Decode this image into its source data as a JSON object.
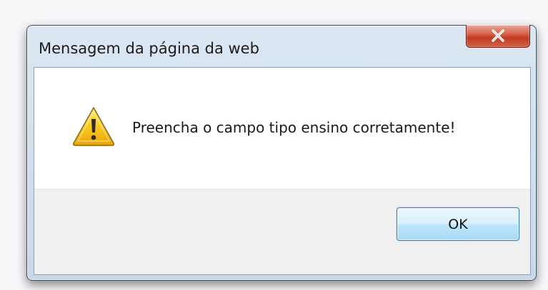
{
  "dialog": {
    "title": "Mensagem da página da web",
    "message": "Preencha o campo tipo ensino corretamente!",
    "ok_label": "OK",
    "close_icon": "close-icon",
    "message_icon": "warning-icon"
  },
  "colors": {
    "frame": "#d2e0ee",
    "close_button": "#c23a22",
    "ok_button_border": "#3c7fb1",
    "button_area": "#f0f0f0"
  }
}
